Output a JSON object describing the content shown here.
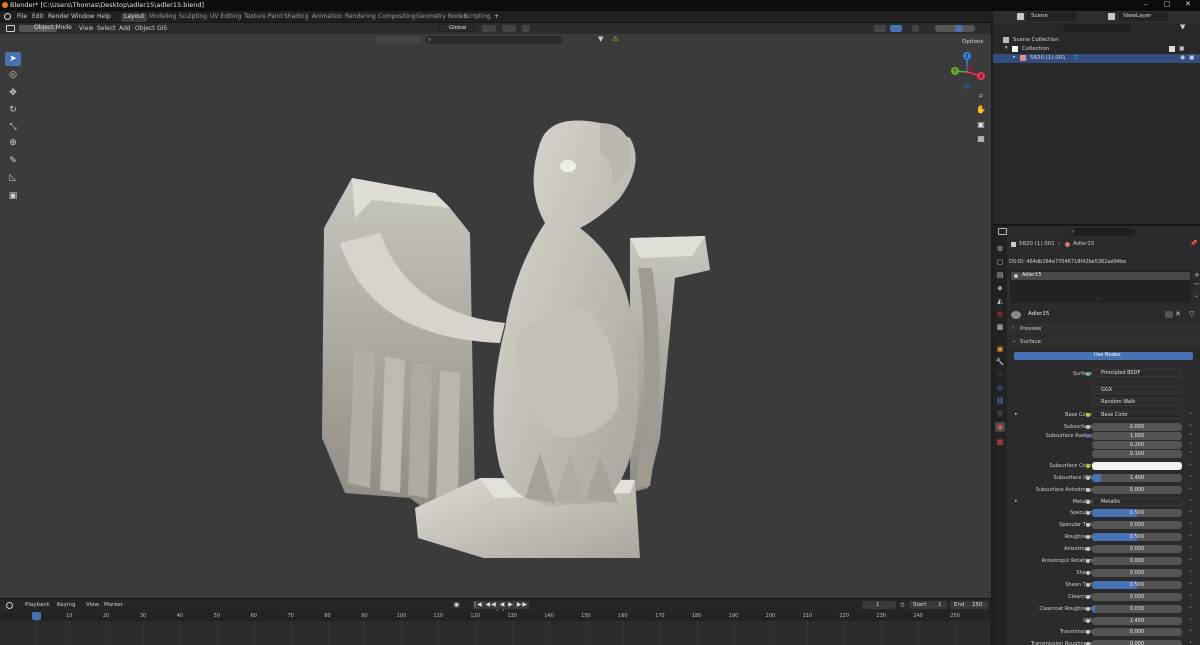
{
  "window": {
    "title": "Blender* [C:\\Users\\Thomas\\Desktop\\adler15\\adler15.blend]",
    "minimize": "–",
    "maximize": "□",
    "close": "✕"
  },
  "menu": {
    "items": [
      "File",
      "Edit",
      "Render",
      "Window",
      "Help"
    ],
    "workspaces": [
      "Layout",
      "Modeling",
      "Sculpting",
      "UV Editing",
      "Texture Paint",
      "Shading",
      "Animation",
      "Rendering",
      "Compositing",
      "Geometry Nodes",
      "Scripting"
    ],
    "active_workspace": "Layout",
    "add_workspace": "+"
  },
  "viewport": {
    "mode": "Object Mode",
    "menus": [
      "View",
      "Select",
      "Add",
      "Object",
      "GIS"
    ],
    "transform_orientation": "Global",
    "options_label": "Options",
    "gizmo_x": "X",
    "gizmo_y": "Y",
    "gizmo_z": "Z",
    "tools": [
      "select-box",
      "cursor",
      "move",
      "rotate",
      "scale",
      "transform",
      "annotate",
      "measure",
      "add-cube"
    ],
    "colors": {
      "background": "#3b3b3b",
      "active_tool": "#4772b3",
      "stone": "#c8c4bc"
    }
  },
  "timeline": {
    "menus": [
      "Playback",
      "Keying",
      "View",
      "Marker"
    ],
    "current_frame": "1",
    "start_label": "Start",
    "start": "1",
    "end_label": "End",
    "end": "250",
    "ruler": [
      "1",
      "10",
      "20",
      "30",
      "40",
      "50",
      "60",
      "70",
      "80",
      "90",
      "100",
      "110",
      "120",
      "130",
      "140",
      "150",
      "160",
      "170",
      "180",
      "190",
      "200",
      "210",
      "220",
      "230",
      "240",
      "250"
    ]
  },
  "outliner": {
    "scene": "Scene",
    "view_layer": "ViewLayer",
    "rows": {
      "scene_collection": "Scene Collection",
      "collection": "Collection",
      "object": "5820 (1).001"
    }
  },
  "properties": {
    "object_name": "5820 (1).001",
    "material_name": "Adler15",
    "ds_id": "DS-ID: 464db164e77046718f42be5362ad94be",
    "slot": "Adler15",
    "slot_dots": "::",
    "material_field": "Adler15",
    "sections": {
      "preview": "Preview",
      "surface": "Surface"
    },
    "use_nodes": "Use Nodes",
    "surface_label": "Surface",
    "surface_value": "Principled BSDF",
    "distribution": "GGX",
    "subsurface_method": "Random Walk",
    "rows": [
      {
        "label": "Base Color",
        "value": "Base Color",
        "kind": "link"
      },
      {
        "label": "Subsurface",
        "value": "0.000",
        "fill": 0
      },
      {
        "label": "Subsurface Radius",
        "value": "1.000",
        "fill": 0
      },
      {
        "label": "",
        "value": "0.200",
        "fill": 0
      },
      {
        "label": "",
        "value": "0.100",
        "fill": 0
      },
      {
        "label": "Subsurface Color",
        "value": "",
        "kind": "color",
        "color": "#f2f2f2"
      },
      {
        "label": "Subsurface IOR",
        "value": "1.400",
        "fill": 0.1
      },
      {
        "label": "Subsurface Anisotropy",
        "value": "0.000",
        "fill": 0
      },
      {
        "label": "Metallic",
        "value": "Metallic",
        "kind": "link"
      },
      {
        "label": "Specular",
        "value": "0.500",
        "fill": 0.5
      },
      {
        "label": "Specular Tint",
        "value": "0.000",
        "fill": 0
      },
      {
        "label": "Roughness",
        "value": "0.500",
        "fill": 0.5
      },
      {
        "label": "Anisotropic",
        "value": "0.000",
        "fill": 0
      },
      {
        "label": "Anisotropic Rotation",
        "value": "0.000",
        "fill": 0
      },
      {
        "label": "Sheen",
        "value": "0.000",
        "fill": 0
      },
      {
        "label": "Sheen Tint",
        "value": "0.500",
        "fill": 0.5
      },
      {
        "label": "Clearcoat",
        "value": "0.000",
        "fill": 0
      },
      {
        "label": "Clearcoat Roughness",
        "value": "0.030",
        "fill": 0.03
      },
      {
        "label": "IOR",
        "value": "1.450",
        "fill": 0
      },
      {
        "label": "Transmission",
        "value": "0.000",
        "fill": 0
      },
      {
        "label": "Transmission Roughness",
        "value": "0.000",
        "fill": 0
      }
    ]
  }
}
